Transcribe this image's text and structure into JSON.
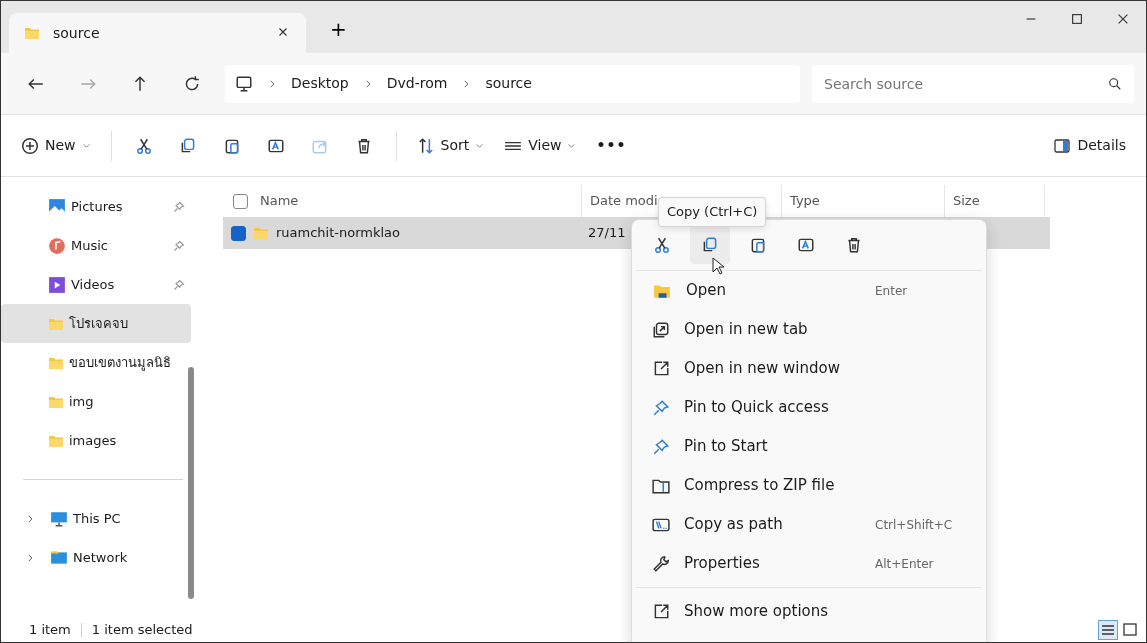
{
  "window": {
    "tab": {
      "title": "source",
      "selected": true
    },
    "new_tab": "+",
    "controls": [
      {
        "kind": "minimize"
      },
      {
        "kind": "maximize"
      },
      {
        "kind": "close"
      }
    ]
  },
  "navigation": {
    "buttons": [
      {
        "kind": "back",
        "disabled": false
      },
      {
        "kind": "forward",
        "disabled": true
      },
      {
        "kind": "up",
        "disabled": false
      },
      {
        "kind": "refresh",
        "disabled": false
      }
    ],
    "breadcrumb": [
      "Desktop",
      "Dvd-rom",
      "source"
    ],
    "search": {
      "placeholder": "Search source"
    }
  },
  "toolbar": [
    {
      "kind": "new",
      "label": "New",
      "disabled": false
    },
    {
      "kind": "cut",
      "disabled": false
    },
    {
      "kind": "copy",
      "disabled": false
    },
    {
      "kind": "paste",
      "disabled": false
    },
    {
      "kind": "rename",
      "disabled": false
    },
    {
      "kind": "share",
      "disabled": true
    },
    {
      "kind": "delete",
      "disabled": false
    },
    {
      "kind": "sort",
      "label": "Sort",
      "disabled": false
    },
    {
      "kind": "view",
      "label": "View",
      "disabled": false
    },
    {
      "kind": "more",
      "label": "•••",
      "disabled": false
    }
  ],
  "details_button": "Details",
  "sidebar": {
    "items": [
      {
        "kind": "pictures",
        "label": "Pictures",
        "pinned": true,
        "selected": false
      },
      {
        "kind": "music",
        "label": "Music",
        "pinned": true,
        "selected": false
      },
      {
        "kind": "videos",
        "label": "Videos",
        "pinned": true,
        "selected": false
      },
      {
        "kind": "folder",
        "label": "โปรเจคจบ",
        "pinned": false,
        "selected": true
      },
      {
        "kind": "folder",
        "label": "ขอบเขตงานมูลนิธิ",
        "pinned": false,
        "selected": false
      },
      {
        "kind": "folder",
        "label": "img",
        "pinned": false,
        "selected": false
      },
      {
        "kind": "folder",
        "label": "images",
        "pinned": false,
        "selected": false
      }
    ],
    "locations": [
      {
        "kind": "pc",
        "label": "This PC",
        "expanded": false
      },
      {
        "kind": "network",
        "label": "Network",
        "expanded": false
      }
    ]
  },
  "table": {
    "select_all_checked": false,
    "columns": [
      "Name",
      "Date modi",
      "Type",
      "Size"
    ],
    "rows": [
      {
        "name": "ruamchit-normklao",
        "date": "27/11",
        "selected": true
      }
    ]
  },
  "tooltip": "Copy (Ctrl+C)",
  "context_menu": {
    "quick_actions": [
      {
        "kind": "cut",
        "hovered": false
      },
      {
        "kind": "copy",
        "hovered": true
      },
      {
        "kind": "paste",
        "hovered": false
      },
      {
        "kind": "rename",
        "hovered": false
      },
      {
        "kind": "delete",
        "hovered": false
      }
    ],
    "items": [
      {
        "kind": "open",
        "label": "Open",
        "shortcut": "Enter"
      },
      {
        "kind": "newtab",
        "label": "Open in new tab"
      },
      {
        "kind": "newwindow",
        "label": "Open in new window"
      },
      {
        "kind": "pin",
        "label": "Pin to Quick access"
      },
      {
        "kind": "pin",
        "label": "Pin to Start"
      },
      {
        "kind": "zip",
        "label": "Compress to ZIP file"
      },
      {
        "kind": "path",
        "label": "Copy as path",
        "shortcut": "Ctrl+Shift+C"
      },
      {
        "kind": "properties",
        "label": "Properties",
        "shortcut": "Alt+Enter"
      }
    ],
    "more": {
      "kind": "more",
      "label": "Show more options"
    }
  },
  "status_bar": {
    "count": "1 item",
    "selection": "1 item selected",
    "views": [
      {
        "kind": "details",
        "selected": true
      },
      {
        "kind": "tiles",
        "selected": false
      }
    ]
  }
}
